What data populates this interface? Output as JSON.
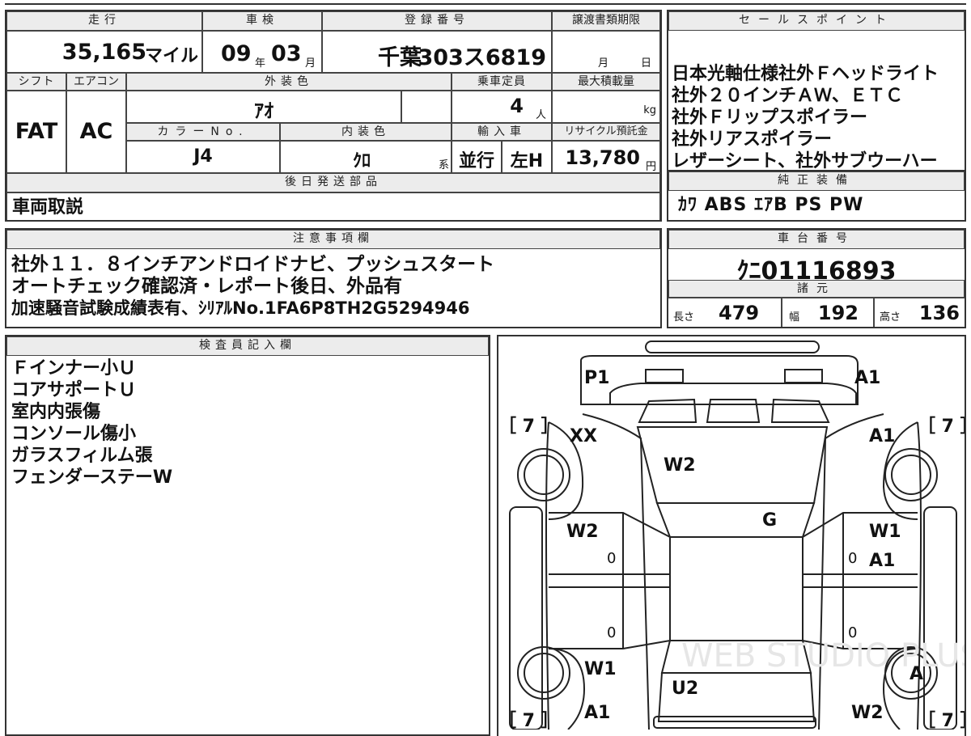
{
  "main": {
    "mileage": {
      "header": "走行",
      "value": "35,165",
      "unit": "マイル"
    },
    "inspection": {
      "header": "車検",
      "year": "09",
      "year_unit": "年",
      "month": "03",
      "month_unit": "月"
    },
    "registration": {
      "header": "登録番号",
      "prefix": "千葉",
      "number": "303ス6819"
    },
    "transfer_deadline": {
      "header": "譲渡書類期限",
      "month_unit": "月",
      "day_unit": "日"
    },
    "shift": {
      "header": "シフト",
      "value": "FAT"
    },
    "aircon": {
      "header": "エアコン",
      "value": "AC"
    },
    "exterior_color": {
      "header": "外装色",
      "value": "ｱｵ"
    },
    "capacity": {
      "header": "乗車定員",
      "value": "4",
      "unit": "人"
    },
    "max_load": {
      "header": "最大積載量",
      "unit": "kg"
    },
    "color_no": {
      "header": "カラーNo.",
      "value": "J4"
    },
    "interior_color": {
      "header": "内装色",
      "value": "ｸﾛ",
      "suffix": "系"
    },
    "import": {
      "header": "輸入車",
      "type": "並行",
      "steering": "左H"
    },
    "recycle": {
      "header": "リサイクル預託金",
      "value": "13,780",
      "unit": "円"
    }
  },
  "later_parts": {
    "header": "後日発送部品",
    "value": "車両取説"
  },
  "sales_points": {
    "header": "セールスポイント",
    "lines": [
      "日本光軸仕様社外Ｆヘッドライト",
      "社外２０インチＡＷ、ＥＴＣ",
      "社外Ｆリップスポイラー",
      "社外リアスポイラー",
      "レザーシート、社外サブウーハー"
    ]
  },
  "standard_equipment": {
    "header": "純正装備",
    "value": "ｶﾜ ABS ｴｱB PS PW"
  },
  "notes": {
    "header": "注意事項欄",
    "lines": [
      "社外１１．８インチアンドロイドナビ、プッシュスタート",
      "オートチェック確認済・レポート後日、外品有",
      "加速騒音試験成績表有、ｼﾘｱﾙNo.1FA6P8TH2G5294946"
    ]
  },
  "chassis": {
    "header": "車台番号",
    "value": "ｸﾆ01116893"
  },
  "specs": {
    "header": "諸元",
    "length_label": "長さ",
    "length": "479",
    "width_label": "幅",
    "width": "192",
    "height_label": "高さ",
    "height": "136"
  },
  "inspector": {
    "header": "検査員記入欄",
    "lines": [
      "Ｆインナー小Ｕ",
      "コアサポートＵ",
      "室内内張傷",
      "コンソール傷小",
      "ガラスフィルム張",
      "フェンダーステーW"
    ]
  },
  "diagram": {
    "tread_left_top": "［ 7 ］",
    "tread_right_top": "［ 7 ］",
    "tread_left_bottom": "［ 7 ］",
    "tread_right_bottom": "［ 7 ］",
    "labels": {
      "front_bumper_left": "P1",
      "front_bumper_right": "A1",
      "front_left_fender": "XX",
      "front_right_fender": "A1",
      "windshield": "W2",
      "roof": "G",
      "front_left_door": "W2",
      "front_right_door": "W1",
      "front_right_door_2": "A1",
      "rear_left_fender": "W1",
      "rear_left_bumper": "A1",
      "rear_right_wheel": "A",
      "rear_right_bumper": "W2",
      "trunk": "U2",
      "fl_zero": "0",
      "fr_zero": "0",
      "rl_zero": "0",
      "rr_zero": "0"
    },
    "watermark": "WEB STUDIO PLUS"
  }
}
